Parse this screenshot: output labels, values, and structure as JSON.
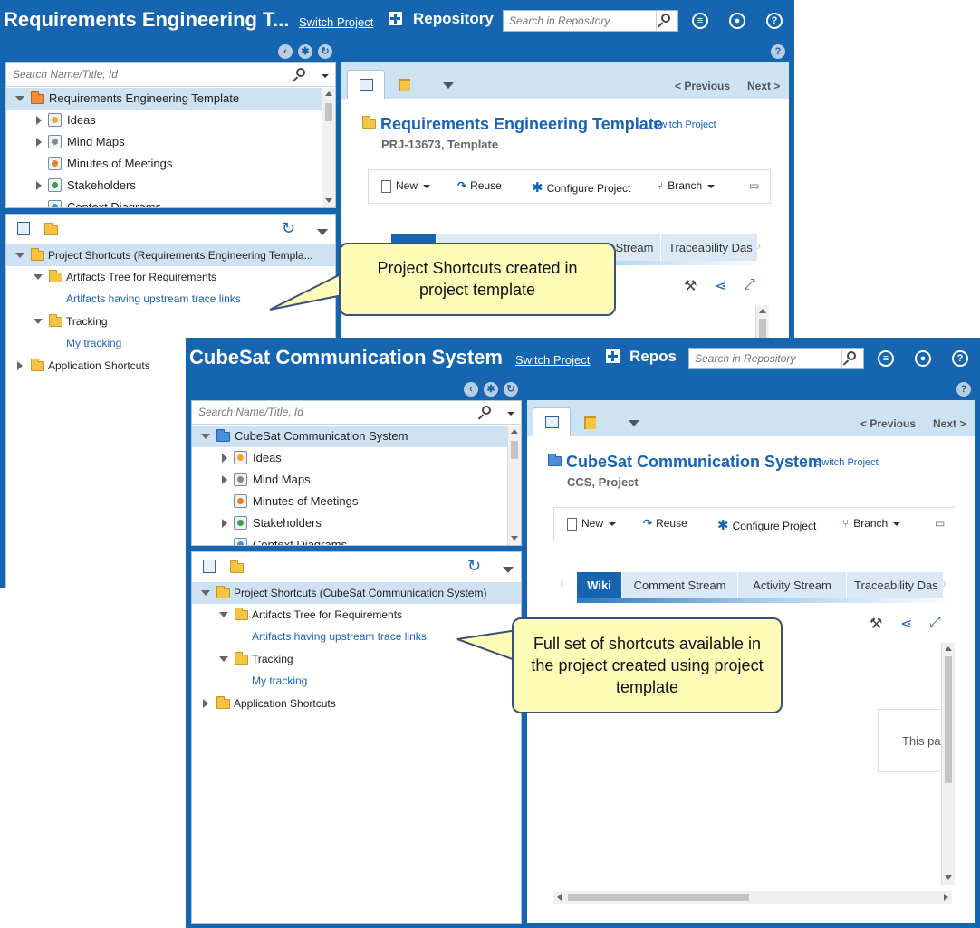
{
  "colors": {
    "header": "#1565b0",
    "link": "#1a62b7",
    "callout": "#fffcb8",
    "tab_active": "#1565b0",
    "tab": "#dbe9f6",
    "selected_row": "#cfe2f3"
  },
  "back": {
    "app_title": "Requirements Engineering T...",
    "switch_project": "Switch Project",
    "repository": "Repository",
    "search_placeholder": "Search in Repository",
    "tree_search_placeholder": "Search Name/Title, Id",
    "tree": [
      {
        "label": "Requirements Engineering Template",
        "icon": "folder-open-icon",
        "selected": true
      },
      {
        "label": "Ideas",
        "icon": "idea-icon"
      },
      {
        "label": "Mind Maps",
        "icon": "mind-map-icon"
      },
      {
        "label": "Minutes of Meetings",
        "icon": "meeting-icon"
      },
      {
        "label": "Stakeholders",
        "icon": "stakeholder-icon"
      },
      {
        "label": "Context Diagrams",
        "icon": "diagram-icon"
      }
    ],
    "shortcuts": [
      {
        "label": "Project Shortcuts (Requirements Engineering Templa...",
        "type": "folder"
      },
      {
        "label": "Artifacts Tree for Requirements",
        "type": "folder"
      },
      {
        "label": "Artifacts having upstream trace links",
        "type": "link"
      },
      {
        "label": "Tracking",
        "type": "folder"
      },
      {
        "label": "My tracking",
        "type": "link"
      },
      {
        "label": "Application Shortcuts",
        "type": "folder"
      }
    ],
    "nav": {
      "previous": "< Previous",
      "next": "Next >"
    },
    "project_title": "Requirements Engineering Template",
    "project_switch": "Switch Project",
    "project_sub": "PRJ-13673, Template",
    "toolbar": {
      "new": "New",
      "reuse": "Reuse",
      "configure": "Configure Project",
      "branch": "Branch"
    },
    "tabs": [
      "",
      "",
      "Stream",
      "Traceability Das"
    ]
  },
  "front": {
    "app_title": "CubeSat Communication System",
    "switch_project": "Switch Project",
    "repository": "Repos",
    "search_placeholder": "Search in Repository",
    "tree_search_placeholder": "Search Name/Title, Id",
    "tree": [
      {
        "label": "CubeSat Communication System",
        "icon": "folder-blue-icon",
        "selected": true
      },
      {
        "label": "Ideas",
        "icon": "idea-icon"
      },
      {
        "label": "Mind Maps",
        "icon": "mind-map-icon"
      },
      {
        "label": "Minutes of Meetings",
        "icon": "meeting-icon"
      },
      {
        "label": "Stakeholders",
        "icon": "stakeholder-icon"
      },
      {
        "label": "Context Diagrams",
        "icon": "diagram-icon"
      }
    ],
    "shortcuts": [
      {
        "label": "Project Shortcuts (CubeSat Communication System)",
        "type": "folder"
      },
      {
        "label": "Artifacts Tree for Requirements",
        "type": "folder"
      },
      {
        "label": "Artifacts having upstream trace links",
        "type": "link"
      },
      {
        "label": "Tracking",
        "type": "folder"
      },
      {
        "label": "My tracking",
        "type": "link"
      },
      {
        "label": "Application Shortcuts",
        "type": "folder"
      }
    ],
    "nav": {
      "previous": "< Previous",
      "next": "Next >"
    },
    "project_title": "CubeSat Communication System",
    "project_switch": "Switch Project",
    "project_sub": "CCS, Project",
    "toolbar": {
      "new": "New",
      "reuse": "Reuse",
      "configure": "Configure Project",
      "branch": "Branch"
    },
    "tabs": [
      "Wiki",
      "Comment Stream",
      "Activity Stream",
      "Traceability Das"
    ],
    "page_preview": "This pa"
  },
  "callouts": {
    "top": "Project Shortcuts created in project template",
    "bottom": "Full set of shortcuts available in the project created using project template"
  }
}
